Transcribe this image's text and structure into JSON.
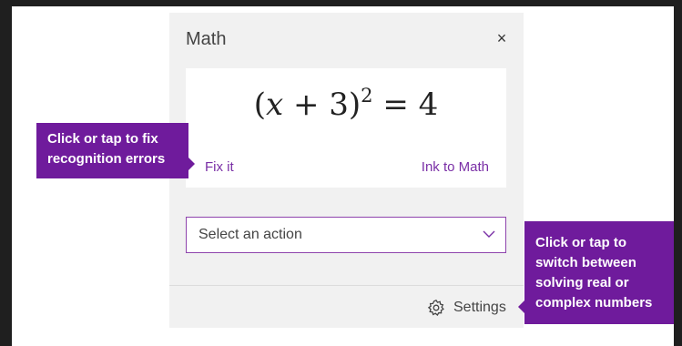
{
  "pane": {
    "title": "Math",
    "close_label": "×",
    "equation": {
      "base_open": "(",
      "var": "x",
      "rest": " + 3)",
      "exponent": "2",
      "rhs": " = 4"
    },
    "fix_it_label": "Fix it",
    "ink_to_math_label": "Ink to Math",
    "action_select": {
      "label": "Select an action",
      "icon": "chevron-down-icon"
    },
    "settings": {
      "icon": "gear-icon",
      "label": "Settings"
    }
  },
  "callouts": {
    "fix_it_tip": [
      "Click or tap to fix",
      "recognition errors"
    ],
    "settings_tip": [
      "Click or tap to",
      "switch between",
      "solving real or",
      "complex numbers"
    ]
  },
  "colors": {
    "accent": "#7a2fa6",
    "callout_bg": "#6f1b9c",
    "pane_bg": "#f1f1f1"
  }
}
